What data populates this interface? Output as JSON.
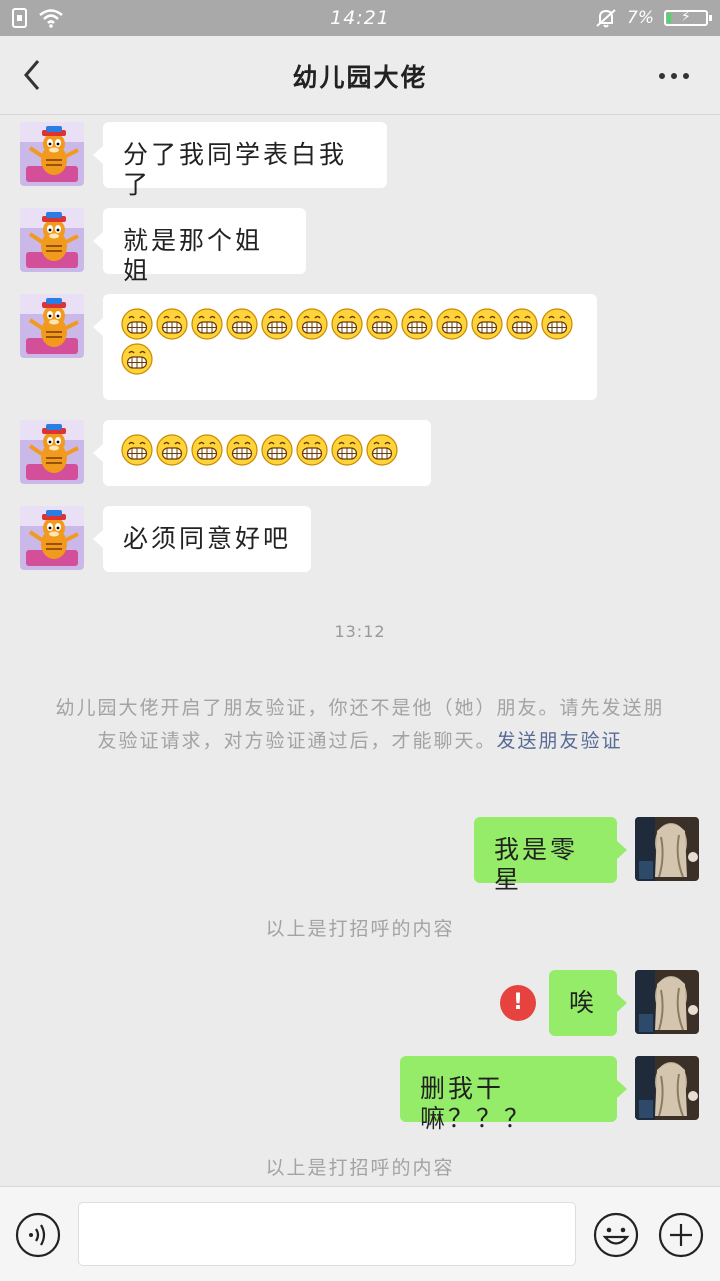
{
  "status_bar": {
    "time": "14:21",
    "battery": "7%"
  },
  "header": {
    "title": "幼儿园大佬"
  },
  "messages": [
    {
      "side": "left",
      "text": "分了我同学表白我了"
    },
    {
      "side": "left",
      "text": "就是那个姐姐"
    },
    {
      "side": "left",
      "emoji": "grin-emoji",
      "count": 14
    },
    {
      "side": "left",
      "emoji": "grin-emoji",
      "count": 8
    },
    {
      "side": "left",
      "text": "必须同意好吧"
    }
  ],
  "system": {
    "time": "13:12",
    "notice": "幼儿园大佬开启了朋友验证，你还不是他（她）朋友。请先发送朋友验证请求，对方验证通过后，才能聊天。",
    "notice_link": "发送朋友验证",
    "greeting_hint_1": "以上是打招呼的内容",
    "greeting_hint_2": "以上是打招呼的内容"
  },
  "sent": [
    {
      "text": "我是零星"
    },
    {
      "text": "唉",
      "failed": true
    },
    {
      "text": "删我干嘛？？？"
    }
  ],
  "input": {
    "value": ""
  },
  "colors": {
    "sent_bubble": "#95ec69",
    "link": "#576b95",
    "error": "#e64340"
  }
}
